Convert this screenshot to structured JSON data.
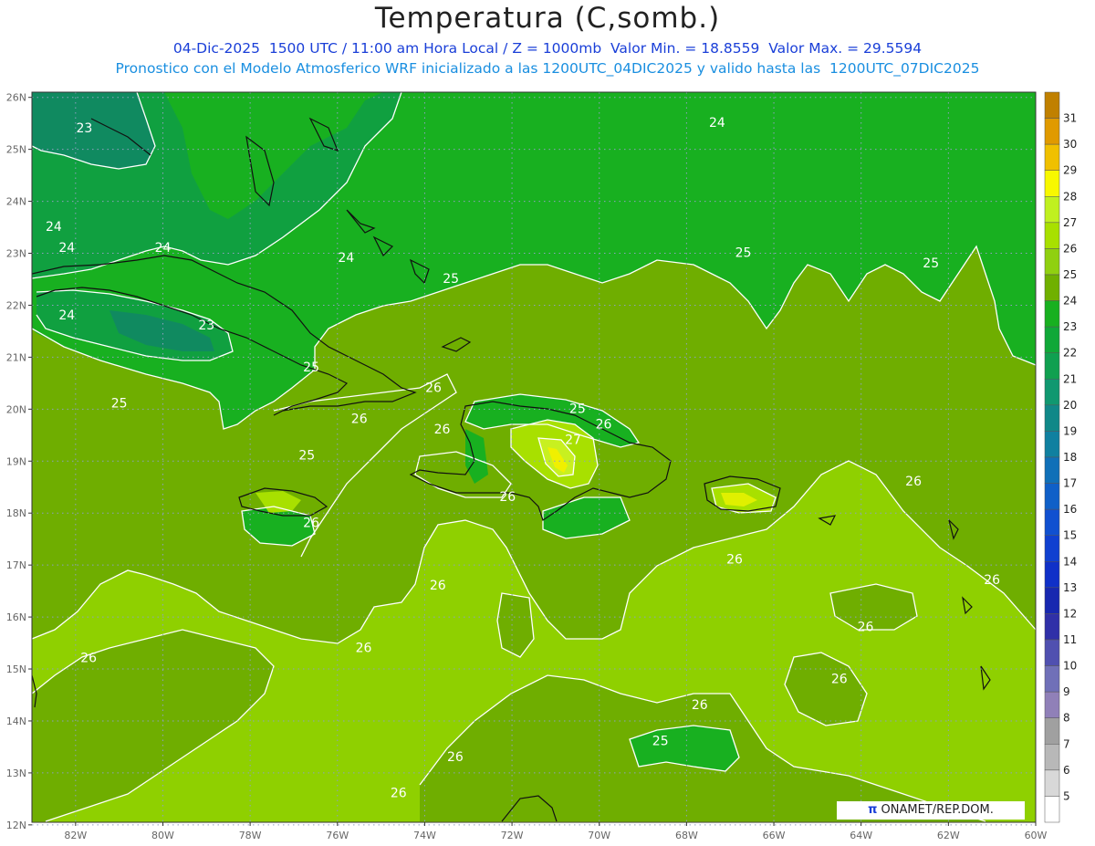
{
  "header": {
    "title": "Temperatura (C,somb.)",
    "subtitle_line1": "04-Dic-2025  1500 UTC / 11:00 am Hora Local / Z = 1000mb  Valor Min. = 18.8559  Valor Max. = 29.5594",
    "subtitle_line2": "Pronostico con el Modelo Atmosferico WRF inicializado a las 1200UTC_04DIC2025 y valido hasta las  1200UTC_07DIC2025"
  },
  "axes": {
    "lat_labels": [
      "26N",
      "25N",
      "24N",
      "23N",
      "22N",
      "21N",
      "20N",
      "19N",
      "18N",
      "17N",
      "16N",
      "15N",
      "14N",
      "13N",
      "12N"
    ],
    "lon_labels": [
      "82W",
      "80W",
      "78W",
      "76W",
      "74W",
      "72W",
      "70W",
      "68W",
      "66W",
      "64W",
      "62W",
      "60W"
    ]
  },
  "colorbar": {
    "labels": [
      "31",
      "30",
      "29",
      "28",
      "27",
      "26",
      "25",
      "24",
      "23",
      "22",
      "21",
      "20",
      "19",
      "18",
      "17",
      "16",
      "15",
      "14",
      "13",
      "12",
      "11",
      "10",
      "9",
      "8",
      "7",
      "6",
      "5"
    ],
    "colors": [
      "#c08000",
      "#e09a00",
      "#f0c000",
      "#f8f800",
      "#c0f020",
      "#a8e000",
      "#90d010",
      "#70b000",
      "#18b020",
      "#10a838",
      "#10a050",
      "#109870",
      "#108888",
      "#1080a0",
      "#1070b8",
      "#1060c8",
      "#1050d0",
      "#1040d0",
      "#1030c8",
      "#1828b0",
      "#3030a8",
      "#5050b0",
      "#7070b8",
      "#9080b8",
      "#a0a0a0",
      "#b8b8b8",
      "#d8d8d8",
      "#ffffff"
    ]
  },
  "contour_labels": [
    {
      "text": "23",
      "lon": -81.8,
      "lat": 25.4
    },
    {
      "text": "24",
      "lon": -67.3,
      "lat": 25.5
    },
    {
      "text": "24",
      "lon": -82.5,
      "lat": 23.5
    },
    {
      "text": "24",
      "lon": -82.2,
      "lat": 23.1
    },
    {
      "text": "24",
      "lon": -80.0,
      "lat": 23.1
    },
    {
      "text": "24",
      "lon": -75.8,
      "lat": 22.9
    },
    {
      "text": "25",
      "lon": -66.7,
      "lat": 23.0
    },
    {
      "text": "25",
      "lon": -62.4,
      "lat": 22.8
    },
    {
      "text": "25",
      "lon": -73.4,
      "lat": 22.5
    },
    {
      "text": "24",
      "lon": -82.2,
      "lat": 21.8
    },
    {
      "text": "23",
      "lon": -79.0,
      "lat": 21.6
    },
    {
      "text": "25",
      "lon": -76.6,
      "lat": 20.8
    },
    {
      "text": "26",
      "lon": -73.8,
      "lat": 20.4
    },
    {
      "text": "25",
      "lon": -81.0,
      "lat": 20.1
    },
    {
      "text": "25",
      "lon": -70.5,
      "lat": 20.0
    },
    {
      "text": "26",
      "lon": -75.5,
      "lat": 19.8
    },
    {
      "text": "26",
      "lon": -73.6,
      "lat": 19.6
    },
    {
      "text": "26",
      "lon": -69.9,
      "lat": 19.7
    },
    {
      "text": "27",
      "lon": -70.6,
      "lat": 19.4
    },
    {
      "text": "25",
      "lon": -76.7,
      "lat": 19.1
    },
    {
      "text": "26",
      "lon": -72.1,
      "lat": 18.3
    },
    {
      "text": "26",
      "lon": -76.6,
      "lat": 17.8
    },
    {
      "text": "26",
      "lon": -62.8,
      "lat": 18.6
    },
    {
      "text": "26",
      "lon": -66.9,
      "lat": 17.1
    },
    {
      "text": "26",
      "lon": -73.7,
      "lat": 16.6
    },
    {
      "text": "26",
      "lon": -61.0,
      "lat": 16.7
    },
    {
      "text": "26",
      "lon": -63.9,
      "lat": 15.8
    },
    {
      "text": "26",
      "lon": -75.4,
      "lat": 15.4
    },
    {
      "text": "26",
      "lon": -81.7,
      "lat": 15.2
    },
    {
      "text": "26",
      "lon": -64.5,
      "lat": 14.8
    },
    {
      "text": "26",
      "lon": -67.7,
      "lat": 14.3
    },
    {
      "text": "25",
      "lon": -68.6,
      "lat": 13.6
    },
    {
      "text": "26",
      "lon": -73.3,
      "lat": 13.3
    },
    {
      "text": "26",
      "lon": -74.6,
      "lat": 12.6
    }
  ],
  "credit": {
    "symbol": "π",
    "text": " ONAMET/REP.DOM."
  }
}
